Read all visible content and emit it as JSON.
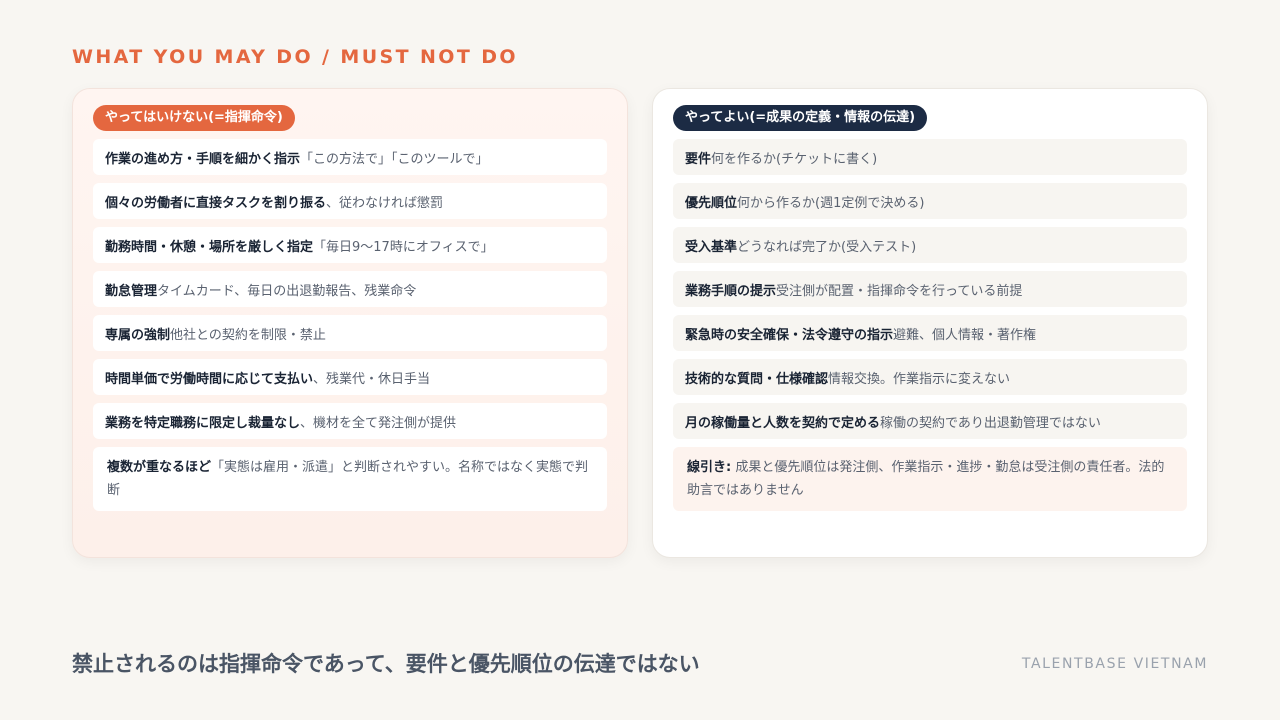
{
  "eyebrow": "WHAT YOU MAY DO / MUST NOT DO",
  "left": {
    "badge": "やってはいけない(=指揮命令)",
    "items": [
      {
        "bold": "作業の進め方・手順を細かく指示",
        "rest": "「この方法で」「このツールで」"
      },
      {
        "bold": "個々の労働者に直接タスクを割り振る",
        "rest": "、従わなければ懲罰"
      },
      {
        "bold": "勤務時間・休憩・場所を厳しく指定",
        "rest": "「毎日9〜17時にオフィスで」"
      },
      {
        "bold": "勤怠管理",
        "rest": " タイムカード、毎日の出退勤報告、残業命令"
      },
      {
        "bold": "専属の強制",
        "rest": " 他社との契約を制限・禁止"
      },
      {
        "bold": "時間単価で労働時間に応じて支払い",
        "rest": "、残業代・休日手当"
      },
      {
        "bold": "業務を特定職務に限定し裁量なし",
        "rest": "、機材を全て発注側が提供"
      }
    ],
    "note": {
      "bold": "複数が重なるほど",
      "rest": "「実態は雇用・派遣」と判断されやすい。名称ではなく実態で判断"
    }
  },
  "right": {
    "badge": "やってよい(=成果の定義・情報の伝達)",
    "items": [
      {
        "bold": "要件",
        "rest": " 何を作るか(チケットに書く)"
      },
      {
        "bold": "優先順位",
        "rest": " 何から作るか(週1定例で決める)"
      },
      {
        "bold": "受入基準",
        "rest": " どうなれば完了か(受入テスト)"
      },
      {
        "bold": "業務手順の提示",
        "rest": " 受注側が配置・指揮命令を行っている前提"
      },
      {
        "bold": "緊急時の安全確保・法令遵守の指示",
        "rest": " 避難、個人情報・著作権"
      },
      {
        "bold": "技術的な質問・仕様確認",
        "rest": " 情報交換。作業指示に変えない"
      },
      {
        "bold": "月の稼働量と人数を契約で定める",
        "rest": " 稼働の契約であり出退勤管理ではない"
      }
    ],
    "note": {
      "bold": "線引き:",
      "rest": " 成果と優先順位は発注側、作業指示・進捗・勤怠は受注側の責任者。法的助言ではありません"
    }
  },
  "footer": "禁止されるのは指揮命令であって、要件と優先順位の伝達ではない",
  "brand": "TALENTBASE VIETNAM"
}
